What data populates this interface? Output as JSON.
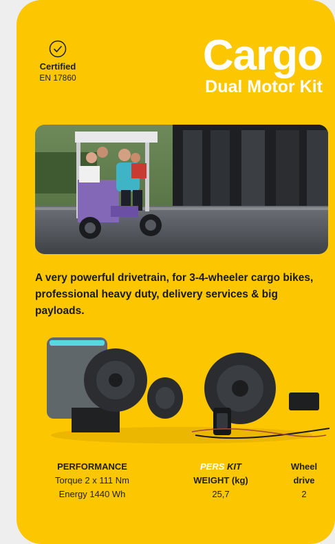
{
  "certification": {
    "label": "Certified",
    "standard": "EN 17860",
    "icon": "check-circle-icon"
  },
  "title": {
    "main": "Cargo",
    "sub": "Dual Motor Kit"
  },
  "description": "A very powerful drivetrain, for 3-4-wheeler cargo bikes, professional heavy duty, delivery services & big payloads.",
  "stats": {
    "performance": {
      "heading": "PERFORMANCE",
      "torque": "Torque 2 x 111 Nm",
      "energy": "Energy 1440 Wh"
    },
    "weight": {
      "brand": "PERS",
      "kit": "KIT",
      "heading": "WEIGHT (kg)",
      "value": "25,7"
    },
    "wheel_drive": {
      "heading_line1": "Wheel",
      "heading_line2": "drive",
      "value": "2"
    }
  },
  "colors": {
    "card": "#fcc600",
    "page": "#eeeeee",
    "title_text": "#ffffff",
    "body_text": "#1a1a1a"
  }
}
